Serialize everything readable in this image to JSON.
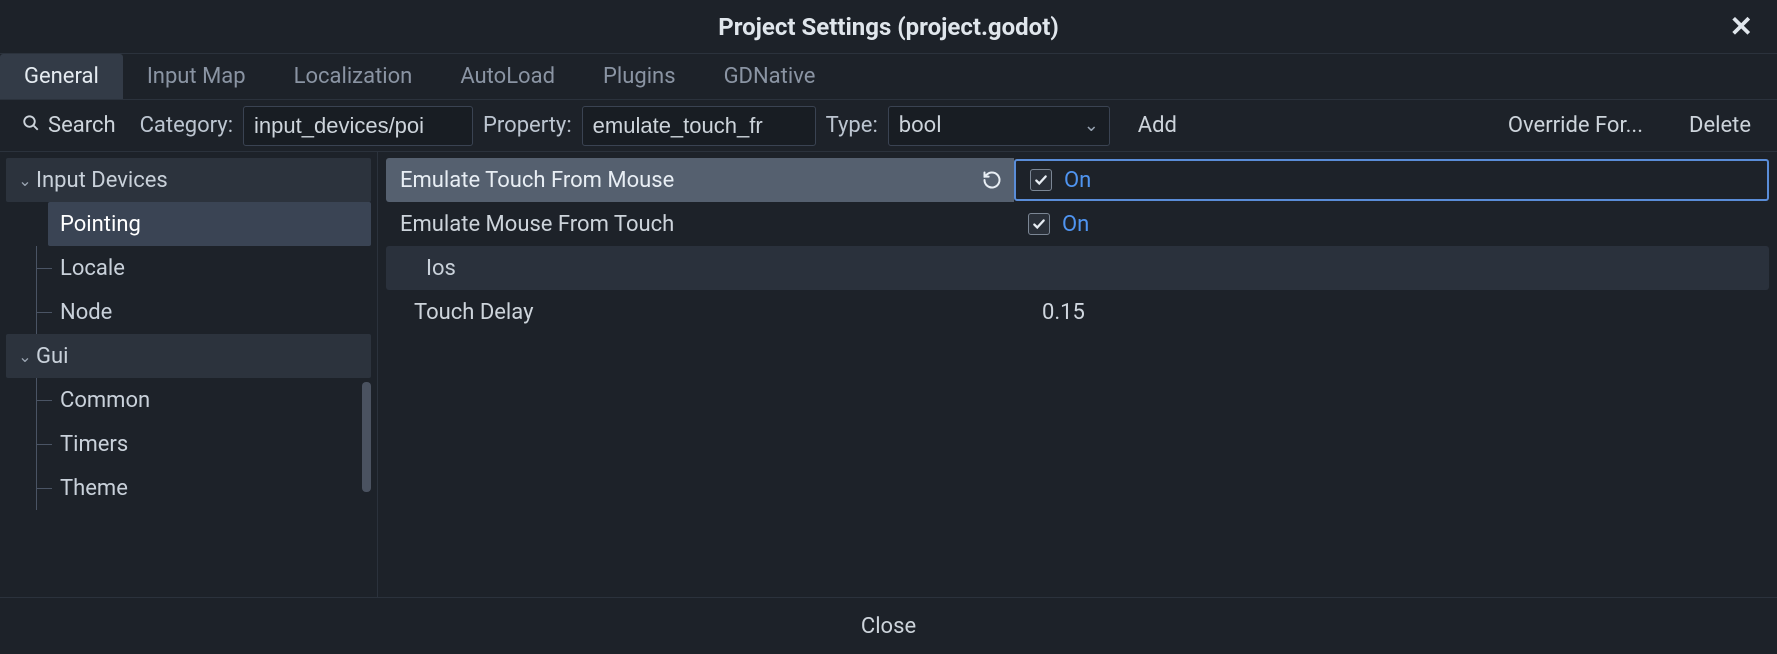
{
  "title": "Project Settings (project.godot)",
  "tabs": [
    "General",
    "Input Map",
    "Localization",
    "AutoLoad",
    "Plugins",
    "GDNative"
  ],
  "active_tab": 0,
  "toolbar": {
    "search_label": "Search",
    "category_label": "Category:",
    "category_value": "input_devices/poi",
    "property_label": "Property:",
    "property_value": "emulate_touch_fr",
    "type_label": "Type:",
    "type_value": "bool",
    "add_label": "Add",
    "override_label": "Override For...",
    "delete_label": "Delete"
  },
  "sidebar": {
    "items": [
      {
        "label": "Input Devices",
        "expandable": true,
        "selectedGroup": true
      },
      {
        "label": "Pointing",
        "child": true,
        "selected": true
      },
      {
        "label": "Locale",
        "child": true
      },
      {
        "label": "Node",
        "child": true
      },
      {
        "label": "Gui",
        "expandable": true,
        "selectedGroup": true
      },
      {
        "label": "Common",
        "child": true
      },
      {
        "label": "Timers",
        "child": true
      },
      {
        "label": "Theme",
        "child": true
      }
    ]
  },
  "props": {
    "emulate_touch": {
      "label": "Emulate Touch From Mouse",
      "value": "On"
    },
    "emulate_mouse": {
      "label": "Emulate Mouse From Touch",
      "value": "On"
    },
    "ios_section": "Ios",
    "touch_delay": {
      "label": "Touch Delay",
      "value": "0.15"
    }
  },
  "footer": {
    "close": "Close"
  }
}
